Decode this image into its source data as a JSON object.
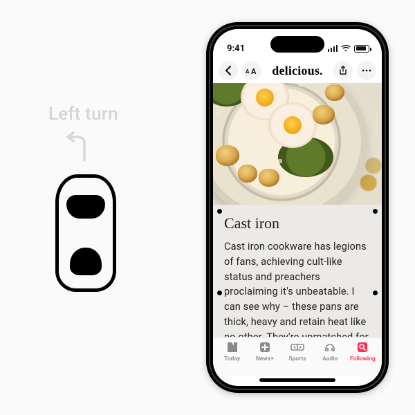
{
  "left": {
    "label": "Left turn"
  },
  "status": {
    "time": "9:41"
  },
  "nav": {
    "title": "delicious."
  },
  "article": {
    "heading": "Cast iron",
    "body": "Cast iron cookware has legions of fans, achieving cult-like status and preachers proclaiming it's unbeatable. I can see why – these pans are thick, heavy and retain heat like no other. They're unmatched for meat that needs a strong sear; hav-"
  },
  "tabs": {
    "today": "Today",
    "newsplus": "News+",
    "sports": "Sports",
    "audio": "Audio",
    "following": "Following"
  }
}
